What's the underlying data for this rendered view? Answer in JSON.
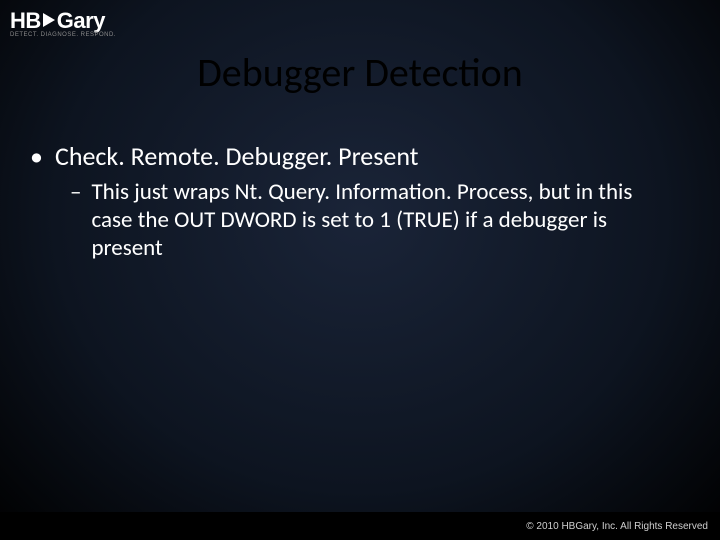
{
  "logo": {
    "part1": "HB",
    "part2": "Gary",
    "tagline": "DETECT. DIAGNOSE. RESPOND."
  },
  "title": "Debugger Detection",
  "bullets": {
    "l1": {
      "marker": "•",
      "text": "Check. Remote. Debugger. Present"
    },
    "l2": {
      "marker": "–",
      "text": "This just wraps Nt. Query. Information. Process, but in this case the OUT DWORD is set to 1 (TRUE) if a debugger is present"
    }
  },
  "footer": "© 2010 HBGary, Inc. All Rights Reserved"
}
